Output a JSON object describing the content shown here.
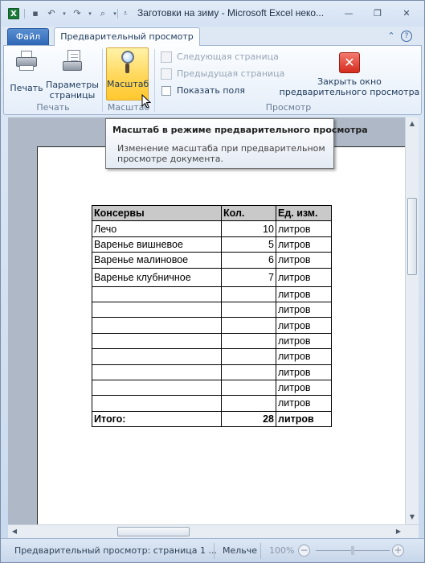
{
  "window": {
    "title": "Заготовки на зиму  -  Microsoft Excel неко..."
  },
  "tabs": {
    "file": "Файл",
    "active": "Предварительный просмотр"
  },
  "ribbon": {
    "groups": {
      "print": {
        "label": "Печать",
        "print_button": "Печать",
        "params_line1": "Параметры",
        "params_line2": "страницы"
      },
      "zoom": {
        "label": "Масштаб",
        "zoom_button": "Масштаб"
      },
      "preview": {
        "label": "Просмотр",
        "next_page": "Следующая страница",
        "prev_page": "Предыдущая страница",
        "show_margins": "Показать поля",
        "close_line1": "Закрыть окно",
        "close_line2": "предварительного просмотра"
      }
    }
  },
  "tooltip": {
    "title": "Масштаб в режиме предварительного просмотра",
    "body": "Изменение масштаба при предварительном просмотре документа."
  },
  "table": {
    "headers": [
      "Консервы",
      "Кол.",
      "Ед. изм."
    ],
    "rows": [
      [
        "Лечо",
        "10",
        "литров"
      ],
      [
        "Варенье вишневое",
        "5",
        "литров"
      ],
      [
        "Варенье малиновое",
        "6",
        "литров"
      ],
      [
        "Варенье клубничное",
        "7",
        "литров"
      ],
      [
        "",
        "",
        "литров"
      ],
      [
        "",
        "",
        "литров"
      ],
      [
        "",
        "",
        "литров"
      ],
      [
        "",
        "",
        "литров"
      ],
      [
        "",
        "",
        "литров"
      ],
      [
        "",
        "",
        "литров"
      ],
      [
        "",
        "",
        "литров"
      ],
      [
        "",
        "",
        "литров"
      ]
    ],
    "total": [
      "Итого:",
      "28",
      "литров"
    ]
  },
  "statusbar": {
    "page_info": "Предварительный просмотр: страница 1 ...",
    "zoom_out_label": "Мельче",
    "zoom_level": "100%"
  },
  "icons": {
    "app": "excel-icon",
    "save": "save-icon",
    "undo": "undo-icon",
    "redo": "redo-icon",
    "print_preview": "print-preview-icon",
    "customize": "customize-qat-icon",
    "minimize": "minimize-icon",
    "restore": "restore-icon",
    "close": "close-icon",
    "help": "help-icon",
    "collapse": "collapse-ribbon-icon"
  },
  "colors": {
    "file_tab": "#2e67b6",
    "active_button": "#ffd75a",
    "close_button": "#d32c1e",
    "header_fill": "#c9c9c9"
  }
}
